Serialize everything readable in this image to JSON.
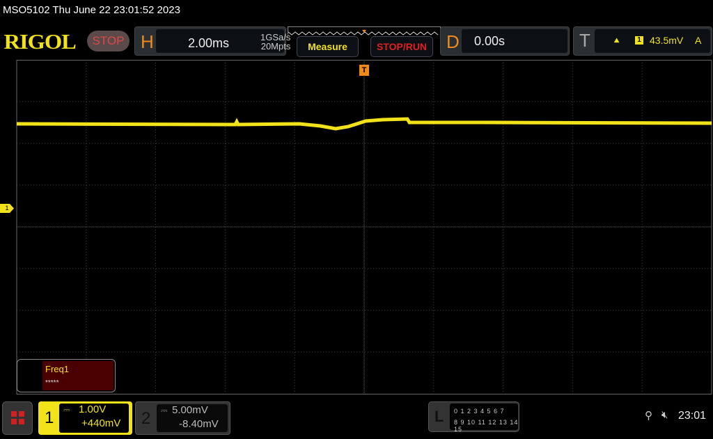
{
  "title": "MSO5102  Thu June 22 23:01:52 2023",
  "logo": "RIGOL",
  "run_state": "STOP",
  "horizontal": {
    "label": "H",
    "timebase": "2.00ms",
    "sample_rate": "1GSa/s",
    "memory_depth": "20Mpts"
  },
  "buttons": {
    "measure": "Measure",
    "stop_run": "STOP/RUN"
  },
  "delay": {
    "label": "D",
    "value": "0.00s"
  },
  "trigger": {
    "label": "T",
    "edge_icon": "rising-edge-icon",
    "source": "1",
    "level": "43.5mV",
    "mode": "A",
    "marker": "T"
  },
  "measurement": {
    "name": "Freq1",
    "value": "*****"
  },
  "channels": [
    {
      "number": "1",
      "scale": "1.00V",
      "offset": "+440mV",
      "color": "#f2e21a",
      "coupling_icon": "dc-coupling-icon"
    },
    {
      "number": "2",
      "scale": "5.00mV",
      "offset": "-8.40mV",
      "color": "#888888",
      "coupling_icon": "dc-coupling-icon"
    }
  ],
  "ch1_marker": "1",
  "logic": {
    "label": "L",
    "row1": "0 1 2 3  4 5 6 7",
    "row2": "8 9 10 11 12 13 14 15"
  },
  "status": {
    "usb_icon": "usb-icon",
    "speaker_icon": "speaker-muted-icon",
    "time": "23:01"
  }
}
